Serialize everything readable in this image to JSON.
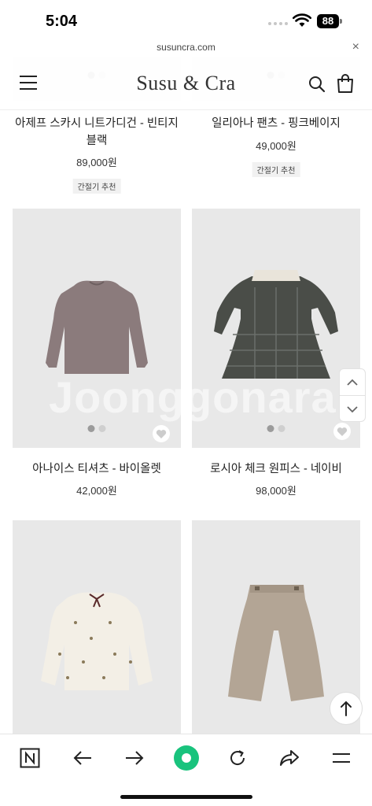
{
  "status_bar": {
    "time": "5:04",
    "battery": "88"
  },
  "browser": {
    "url": "susuncra.com",
    "close_glyph": "×"
  },
  "header": {
    "logo": "Susu & Cra",
    "menu_icon": "hamburger-icon",
    "search_icon": "search-icon",
    "cart_icon": "shopping-bag-icon"
  },
  "products": [
    {
      "name": "아제프 스카시 니트가디건 - 빈티지블랙",
      "price": "89,000원",
      "tag": "간절기 추천"
    },
    {
      "name": "일리아나 팬츠 - 핑크베이지",
      "price": "49,000원",
      "tag": "간절기 추천"
    },
    {
      "name": "아나이스 티셔츠 - 바이올렛",
      "price": "42,000원",
      "tag": ""
    },
    {
      "name": "로시아 체크 원피스 - 네이비",
      "price": "98,000원",
      "tag": ""
    },
    {
      "name": "",
      "price": "",
      "tag": ""
    },
    {
      "name": "",
      "price": "",
      "tag": ""
    }
  ],
  "watermark": "Joonggonara",
  "colors": {
    "accent_green": "#19c37d",
    "image_bg": "#e8e8e8"
  },
  "bottom_nav": [
    "naver-n-icon",
    "back-arrow-icon",
    "forward-arrow-icon",
    "green-dot-button",
    "refresh-icon",
    "share-icon",
    "menu-icon"
  ]
}
